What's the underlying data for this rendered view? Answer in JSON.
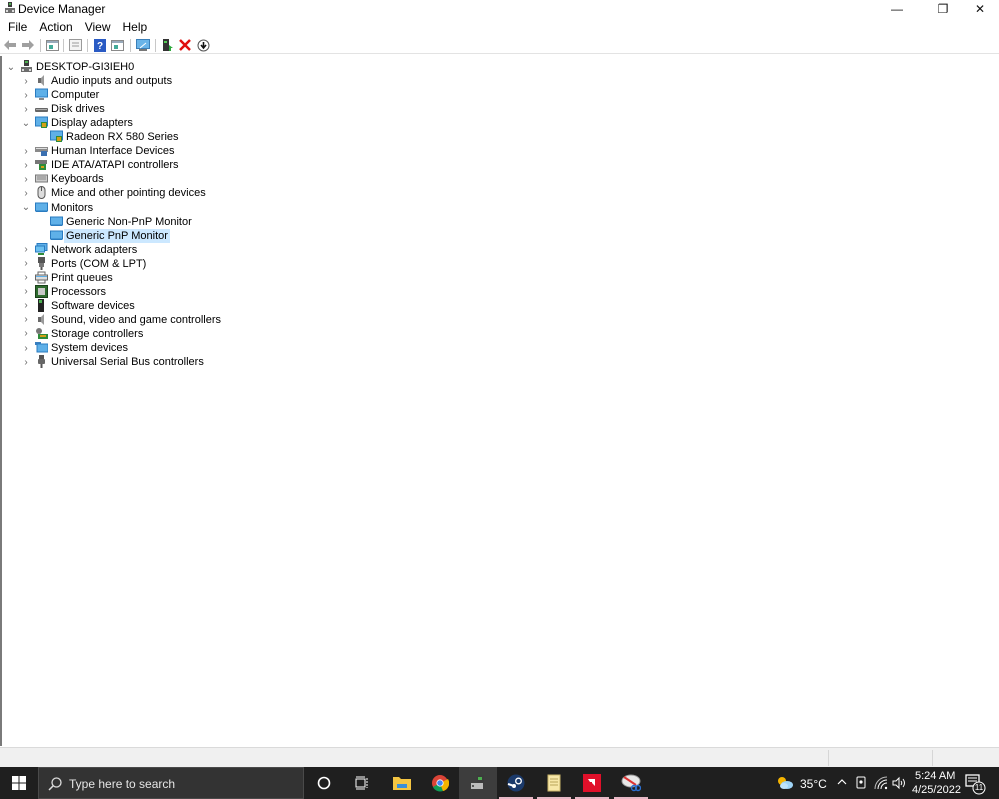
{
  "window": {
    "title": "Device Manager",
    "controls": {
      "minimize": "—",
      "restore": "❐",
      "close": "✕"
    }
  },
  "menu": [
    "File",
    "Action",
    "View",
    "Help"
  ],
  "toolbar": {
    "buttons": [
      {
        "name": "back-icon",
        "glyph": "⇦"
      },
      {
        "name": "forward-icon",
        "glyph": "⇨"
      },
      {
        "name": "show-hide-console-tree-icon",
        "glyph": "▣"
      },
      {
        "name": "properties-icon",
        "glyph": "▤"
      },
      {
        "name": "help-icon",
        "glyph": "?"
      },
      {
        "name": "show-action-pane-icon",
        "glyph": "▣"
      },
      {
        "name": "scan-hardware-changes-icon",
        "glyph": "⎚"
      },
      {
        "name": "update-driver-icon",
        "glyph": "▮"
      },
      {
        "name": "uninstall-device-icon",
        "glyph": "✕"
      },
      {
        "name": "disable-device-icon",
        "glyph": "⊕"
      }
    ]
  },
  "tree": {
    "root": {
      "label": "DESKTOP-GI3IEH0",
      "icon": "computer-root-icon",
      "expanded": true
    },
    "items": [
      {
        "label": "Audio inputs and outputs",
        "icon": "speaker-icon",
        "level": 1,
        "expander": "collapsed"
      },
      {
        "label": "Computer",
        "icon": "computer-icon",
        "level": 1,
        "expander": "collapsed"
      },
      {
        "label": "Disk drives",
        "icon": "disk-drive-icon",
        "level": 1,
        "expander": "collapsed"
      },
      {
        "label": "Display adapters",
        "icon": "display-adapter-icon",
        "level": 1,
        "expander": "expanded"
      },
      {
        "label": "Radeon RX 580 Series",
        "icon": "display-adapter-icon",
        "level": 2,
        "expander": "none"
      },
      {
        "label": "Human Interface Devices",
        "icon": "hid-icon",
        "level": 1,
        "expander": "collapsed"
      },
      {
        "label": "IDE ATA/ATAPI controllers",
        "icon": "ide-controller-icon",
        "level": 1,
        "expander": "collapsed"
      },
      {
        "label": "Keyboards",
        "icon": "keyboard-icon",
        "level": 1,
        "expander": "collapsed"
      },
      {
        "label": "Mice and other pointing devices",
        "icon": "mouse-icon",
        "level": 1,
        "expander": "collapsed"
      },
      {
        "label": "Monitors",
        "icon": "monitor-icon",
        "level": 1,
        "expander": "expanded"
      },
      {
        "label": "Generic Non-PnP Monitor",
        "icon": "monitor-icon",
        "level": 2,
        "expander": "none"
      },
      {
        "label": "Generic PnP Monitor",
        "icon": "monitor-icon",
        "level": 2,
        "expander": "none",
        "selected": true
      },
      {
        "label": "Network adapters",
        "icon": "network-adapter-icon",
        "level": 1,
        "expander": "collapsed"
      },
      {
        "label": "Ports (COM & LPT)",
        "icon": "port-icon",
        "level": 1,
        "expander": "collapsed"
      },
      {
        "label": "Print queues",
        "icon": "printer-icon",
        "level": 1,
        "expander": "collapsed"
      },
      {
        "label": "Processors",
        "icon": "processor-icon",
        "level": 1,
        "expander": "collapsed"
      },
      {
        "label": "Software devices",
        "icon": "software-device-icon",
        "level": 1,
        "expander": "collapsed"
      },
      {
        "label": "Sound, video and game controllers",
        "icon": "speaker-icon",
        "level": 1,
        "expander": "collapsed"
      },
      {
        "label": "Storage controllers",
        "icon": "storage-controller-icon",
        "level": 1,
        "expander": "collapsed"
      },
      {
        "label": "System devices",
        "icon": "system-devices-icon",
        "level": 1,
        "expander": "collapsed"
      },
      {
        "label": "Universal Serial Bus controllers",
        "icon": "usb-icon",
        "level": 1,
        "expander": "collapsed"
      }
    ]
  },
  "taskbar": {
    "search_placeholder": "Type here to search",
    "apps": [
      {
        "name": "cortana-icon",
        "state": ""
      },
      {
        "name": "task-view-icon",
        "state": ""
      },
      {
        "name": "file-explorer-icon",
        "state": ""
      },
      {
        "name": "chrome-icon",
        "state": ""
      },
      {
        "name": "device-manager-taskbar-icon",
        "state": "active"
      },
      {
        "name": "steam-icon",
        "state": "open"
      },
      {
        "name": "notepad-icon",
        "state": "open"
      },
      {
        "name": "amd-radeon-icon",
        "state": "open"
      },
      {
        "name": "snipping-tool-icon",
        "state": "open"
      }
    ],
    "weather": "35°C",
    "time": "5:24 AM",
    "date": "4/25/2022",
    "notification_count": "11"
  },
  "colors": {
    "selection": "#cce8ff",
    "taskbar_bg": "#1f1f1f",
    "monitor_blue": "#3c9ad8"
  }
}
